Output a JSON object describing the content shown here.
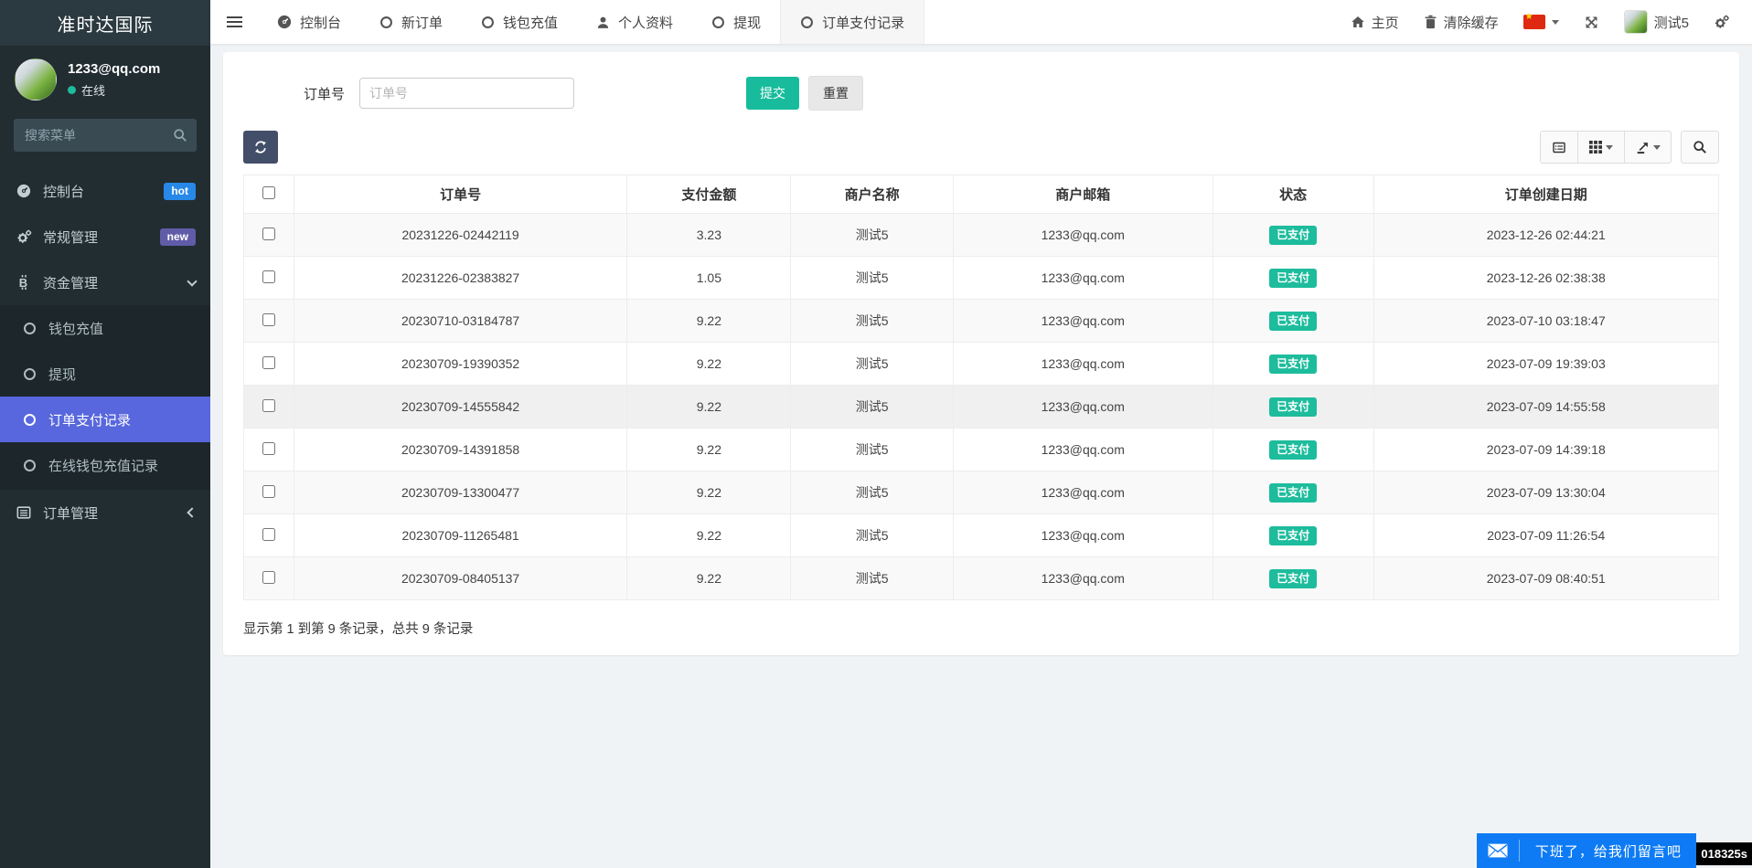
{
  "brand": "准时达国际",
  "user": {
    "email": "1233@qq.com",
    "status_label": "在线",
    "display_name": "测试5"
  },
  "sidebar": {
    "search_placeholder": "搜索菜单",
    "items": [
      {
        "label": "控制台",
        "badge": "hot"
      },
      {
        "label": "常规管理",
        "badge": "new"
      },
      {
        "label": "资金管理",
        "children": [
          "钱包充值",
          "提现",
          "订单支付记录",
          "在线钱包充值记录"
        ],
        "active_child": "订单支付记录"
      },
      {
        "label": "订单管理"
      }
    ]
  },
  "topbar": {
    "tabs": [
      {
        "label": "控制台",
        "icon": "dashboard",
        "active": false
      },
      {
        "label": "新订单",
        "icon": "circle",
        "active": false
      },
      {
        "label": "钱包充值",
        "icon": "circle",
        "active": false
      },
      {
        "label": "个人资料",
        "icon": "user",
        "active": false
      },
      {
        "label": "提现",
        "icon": "circle",
        "active": false
      },
      {
        "label": "订单支付记录",
        "icon": "circle",
        "active": true
      }
    ],
    "home_label": "主页",
    "clear_cache_label": "清除缓存"
  },
  "filter": {
    "label": "订单号",
    "placeholder": "订单号",
    "submit_label": "提交",
    "reset_label": "重置"
  },
  "table": {
    "columns": [
      "订单号",
      "支付金额",
      "商户名称",
      "商户邮箱",
      "状态",
      "订单创建日期"
    ],
    "rows": [
      {
        "order_no": "20231226-02442119",
        "amount": "3.23",
        "merchant": "测试5",
        "email": "1233@qq.com",
        "status": "已支付",
        "created": "2023-12-26 02:44:21"
      },
      {
        "order_no": "20231226-02383827",
        "amount": "1.05",
        "merchant": "测试5",
        "email": "1233@qq.com",
        "status": "已支付",
        "created": "2023-12-26 02:38:38"
      },
      {
        "order_no": "20230710-03184787",
        "amount": "9.22",
        "merchant": "测试5",
        "email": "1233@qq.com",
        "status": "已支付",
        "created": "2023-07-10 03:18:47"
      },
      {
        "order_no": "20230709-19390352",
        "amount": "9.22",
        "merchant": "测试5",
        "email": "1233@qq.com",
        "status": "已支付",
        "created": "2023-07-09 19:39:03"
      },
      {
        "order_no": "20230709-14555842",
        "amount": "9.22",
        "merchant": "测试5",
        "email": "1233@qq.com",
        "status": "已支付",
        "created": "2023-07-09 14:55:58",
        "highlighted": true
      },
      {
        "order_no": "20230709-14391858",
        "amount": "9.22",
        "merchant": "测试5",
        "email": "1233@qq.com",
        "status": "已支付",
        "created": "2023-07-09 14:39:18"
      },
      {
        "order_no": "20230709-13300477",
        "amount": "9.22",
        "merchant": "测试5",
        "email": "1233@qq.com",
        "status": "已支付",
        "created": "2023-07-09 13:30:04"
      },
      {
        "order_no": "20230709-11265481",
        "amount": "9.22",
        "merchant": "测试5",
        "email": "1233@qq.com",
        "status": "已支付",
        "created": "2023-07-09 11:26:54"
      },
      {
        "order_no": "20230709-08405137",
        "amount": "9.22",
        "merchant": "测试5",
        "email": "1233@qq.com",
        "status": "已支付",
        "created": "2023-07-09 08:40:51"
      }
    ],
    "summary": "显示第 1 到第 9 条记录，总共 9 条记录"
  },
  "chat": {
    "message": "下班了，给我们留言吧",
    "timer": "018325s"
  },
  "colors": {
    "sidebar_bg": "#222d32",
    "active_item": "#5867dd",
    "hot_badge": "#2788e8",
    "new_badge": "#605ca8",
    "submit_green": "#18bc9c",
    "paid_badge": "#1dbc9c",
    "chat_blue": "#0e7bf5",
    "refresh_btn": "#434e68"
  }
}
